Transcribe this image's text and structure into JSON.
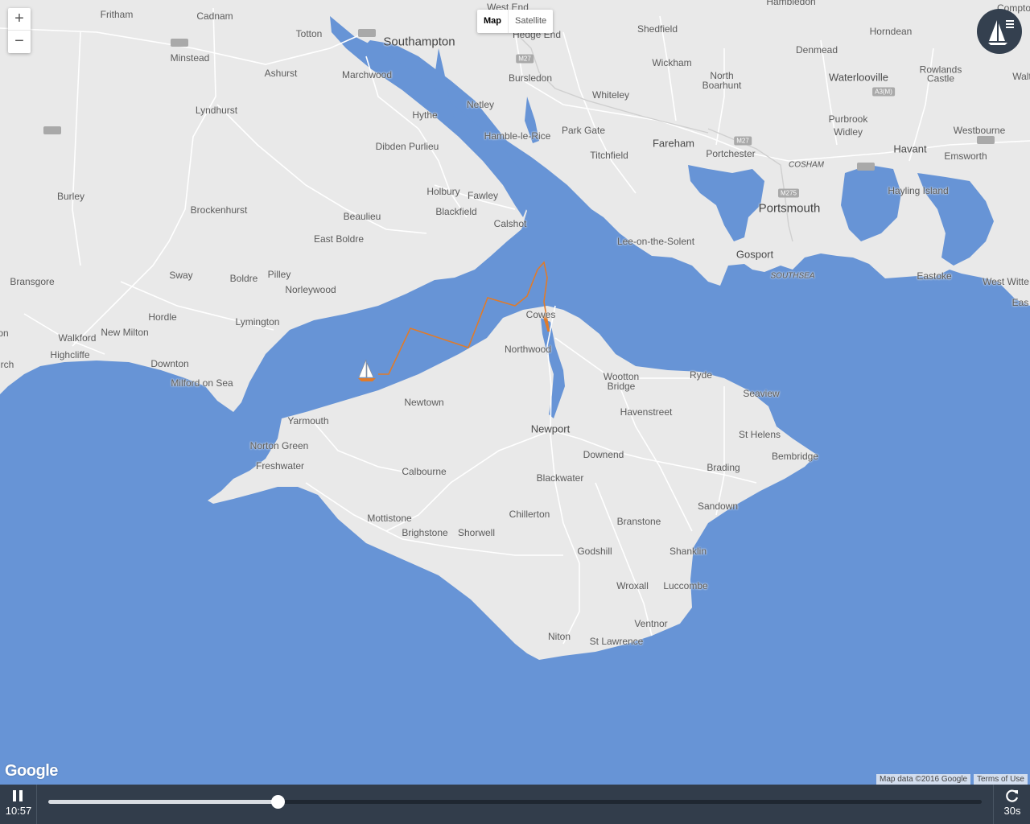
{
  "map": {
    "type_buttons": [
      "Map",
      "Satellite"
    ],
    "zoom_in": "+",
    "zoom_out": "−",
    "logo": "Google",
    "attribution": "Map data ©2016 Google",
    "terms": "Terms of Use",
    "places": {
      "southampton": "Southampton",
      "portsmouth": "Portsmouth",
      "newport": "Newport",
      "fareham": "Fareham",
      "waterlooville": "Waterlooville",
      "havant": "Havant",
      "gosport": "Gosport",
      "cowes": "Cowes",
      "fritham": "Fritham",
      "cadnam": "Cadnam",
      "totton": "Totton",
      "hedge_end": "Hedge End",
      "shedfield": "Shedfield",
      "horndean": "Horndean",
      "minstead": "Minstead",
      "ashurst": "Ashurst",
      "marchwood": "Marchwood",
      "bursledon": "Bursledon",
      "wickham": "Wickham",
      "denmead": "Denmead",
      "north_boarhunt": "North\nBoarhunt",
      "rowlands_castle": "Rowlands\nCastle",
      "lyndhurst": "Lyndhurst",
      "netley": "Netley",
      "hythe": "Hythe",
      "whiteley": "Whiteley",
      "park_gate": "Park Gate",
      "hamble": "Hamble-le-Rice",
      "purbrook": "Purbrook",
      "widley": "Widley",
      "westbourne": "Westbourne",
      "emsworth": "Emsworth",
      "dibden": "Dibden Purlieu",
      "titchfield": "Titchfield",
      "portchester": "Portchester",
      "cosham": "COSHAM",
      "burley": "Burley",
      "holbury": "Holbury",
      "fawley": "Fawley",
      "hayling": "Hayling Island",
      "brockenhurst": "Brockenhurst",
      "blackfield": "Blackfield",
      "beaulieu": "Beaulieu",
      "calshot": "Calshot",
      "lee": "Lee-on-the-Solent",
      "east_boldre": "East Boldre",
      "sway": "Sway",
      "boldre": "Boldre",
      "pilley": "Pilley",
      "bransgore": "Bransgore",
      "norleywood": "Norleywood",
      "southsea": "SOUTHSEA",
      "eastoke": "Eastoke",
      "west_wittering": "West Witte",
      "hordle": "Hordle",
      "lymington": "Lymington",
      "walkford": "Walkford",
      "new_milton": "New Milton",
      "highcliffe": "Highcliffe",
      "northwood": "Northwood",
      "downton": "Downton",
      "milford": "Milford on Sea",
      "wootton": "Wootton\nBridge",
      "ryde": "Ryde",
      "seaview": "Seaview",
      "newtown": "Newtown",
      "havenstreet": "Havenstreet",
      "yarmouth": "Yarmouth",
      "st_helens": "St Helens",
      "norton_green": "Norton Green",
      "bembridge": "Bembridge",
      "downend": "Downend",
      "freshwater": "Freshwater",
      "calbourne": "Calbourne",
      "brading": "Brading",
      "blackwater": "Blackwater",
      "sandown": "Sandown",
      "mottistone": "Mottistone",
      "chillerton": "Chillerton",
      "branstone": "Branstone",
      "brighstone": "Brighstone",
      "shorwell": "Shorwell",
      "godshill": "Godshill",
      "shanklin": "Shanklin",
      "wroxall": "Wroxall",
      "luccombe": "Luccombe",
      "ventnor": "Ventnor",
      "niton": "Niton",
      "st_lawrence": "St Lawrence",
      "on_edge": "on",
      "rch_edge": "rch",
      "hambledon": "Hambledon",
      "compton": "Compto",
      "west_end": "West End",
      "walt": "Walt",
      "east": "Eas",
      "a3m": "A3(M)",
      "m27_1": "M27",
      "m27_2": "M27",
      "m275": "M275"
    },
    "icons": {
      "menu": "sailboat-menu-icon",
      "boat": "sailboat-marker-icon"
    },
    "colors": {
      "water": "#6794d6",
      "land": "#e9e9e9",
      "track": "#e07b2a",
      "control_bar": "#323d4b"
    }
  },
  "player": {
    "state": "playing",
    "time": "10:57",
    "progress": 0.246,
    "restart_label": "30s"
  }
}
